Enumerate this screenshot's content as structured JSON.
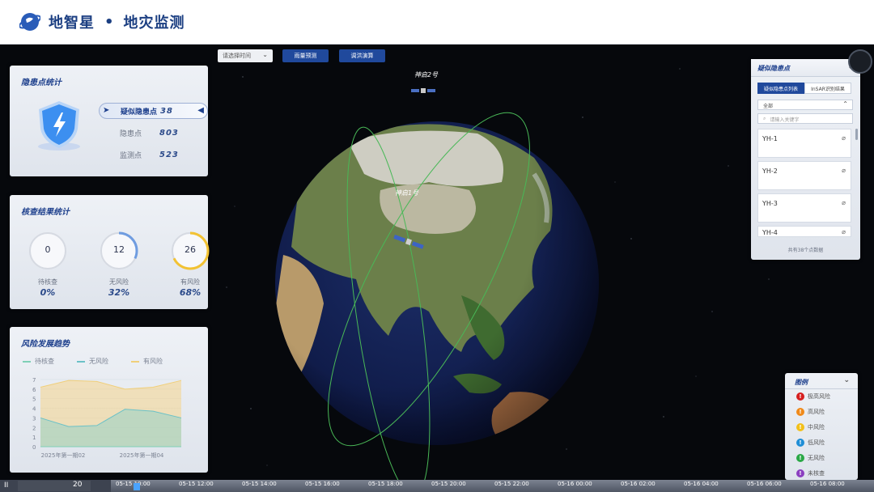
{
  "header": {
    "title": "地智星",
    "separator": "•",
    "subtitle": "地灾监测"
  },
  "controls": {
    "time_select": "请选择时间",
    "btn_forecast": "雨量预测",
    "btn_solve": "调洪演算"
  },
  "hazard_stats": {
    "title": "隐患点统计",
    "rows": [
      {
        "label": "疑似隐患点",
        "value": "38"
      },
      {
        "label": "隐患点",
        "value": "803"
      },
      {
        "label": "监测点",
        "value": "523"
      }
    ]
  },
  "verify_stats": {
    "title": "核查结果统计",
    "rings": [
      {
        "value": "0",
        "label": "待核查",
        "percent": "0%",
        "fraction": 0,
        "color": "#c7cbd3"
      },
      {
        "value": "12",
        "label": "无风险",
        "percent": "32%",
        "fraction": 0.32,
        "color": "#6f9ce0"
      },
      {
        "value": "26",
        "label": "有风险",
        "percent": "68%",
        "fraction": 0.68,
        "color": "#f2c233"
      }
    ]
  },
  "trend": {
    "title": "风险发展趋势",
    "legend": [
      {
        "name": "待核查",
        "color": "#7fd0b6"
      },
      {
        "name": "无风险",
        "color": "#6bc1c7"
      },
      {
        "name": "有风险",
        "color": "#f0cf7a"
      }
    ]
  },
  "chart_data": {
    "type": "area",
    "x": [
      "2025年第一期02",
      "",
      "",
      "2025年第一期04",
      "",
      ""
    ],
    "x_ticks": [
      "2025年第一期02",
      "2025年第一期04"
    ],
    "series": [
      {
        "name": "待核查",
        "values": [
          0,
          0,
          0,
          0,
          0,
          0
        ],
        "color": "#7fd0b6"
      },
      {
        "name": "无风险",
        "values": [
          3,
          2.1,
          2.2,
          3.9,
          3.7,
          3
        ],
        "color": "#6bc1c7"
      },
      {
        "name": "有风险",
        "values": [
          6.2,
          6.9,
          6.8,
          6,
          6.2,
          6.9
        ],
        "color": "#f0cf7a"
      }
    ],
    "ylim": [
      0,
      7
    ],
    "y_ticks": [
      "0",
      "1",
      "2",
      "3",
      "4",
      "5",
      "6",
      "7"
    ]
  },
  "globe": {
    "sat1": "神启2号",
    "sat2": "神启1号"
  },
  "suspect_list": {
    "title": "疑似隐患点",
    "tab_active": "疑似隐患点列表",
    "tab_other": "InSAR识别结果",
    "filter": "全部",
    "search_placeholder": "请输入关键字",
    "items": [
      "YH-1",
      "YH-2",
      "YH-3",
      "YH-4"
    ],
    "footer": "共有38个点数据"
  },
  "risk_legend": {
    "title": "图例",
    "items": [
      {
        "label": "极高风险",
        "color": "#d62020"
      },
      {
        "label": "高风险",
        "color": "#f08a1a"
      },
      {
        "label": "中风险",
        "color": "#f2c01a"
      },
      {
        "label": "低风险",
        "color": "#1f8ed6"
      },
      {
        "label": "无风险",
        "color": "#2aa846"
      },
      {
        "label": "未核查",
        "color": "#8b3fc0"
      }
    ]
  },
  "timeline": {
    "pause": "II",
    "speed": "20",
    "labels": [
      "05-15 10:00",
      "05-15 12:00",
      "05-15 14:00",
      "05-15 16:00",
      "05-15 18:00",
      "05-15 20:00",
      "05-15 22:00",
      "05-16 00:00",
      "05-16 02:00",
      "05-16 04:00",
      "05-16 06:00",
      "05-16 08:00"
    ]
  }
}
